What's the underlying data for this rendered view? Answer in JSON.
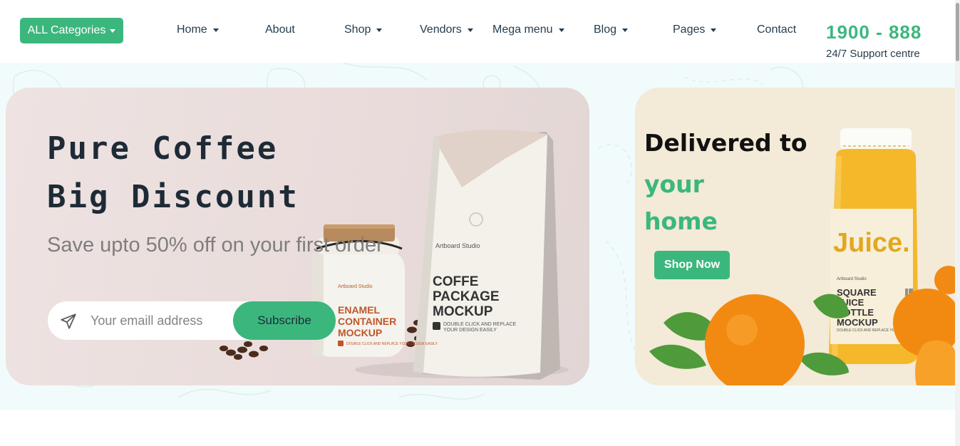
{
  "header": {
    "categories_label": "ALL Categories",
    "nav": [
      {
        "label": "Home",
        "dropdown": true
      },
      {
        "label": "About",
        "dropdown": false
      },
      {
        "label": "Shop",
        "dropdown": true
      },
      {
        "label": "Vendors",
        "dropdown": true
      },
      {
        "label": "Mega menu",
        "dropdown": true
      },
      {
        "label": "Blog",
        "dropdown": true
      },
      {
        "label": "Pages",
        "dropdown": true
      },
      {
        "label": "Contact",
        "dropdown": false
      }
    ],
    "hotline": "1900 - 888",
    "support": "24/7 Support centre"
  },
  "hero": {
    "title_line1": "Pure Coffee",
    "title_line2": "Big Discount",
    "subtitle": "Save upto 50% off on your first order",
    "email_placeholder": "Your emaill address",
    "subscribe_label": "Subscribe",
    "jar": {
      "brand": "Artboard Studio",
      "line1": "ENAMEL",
      "line2": "CONTAINER",
      "line3": "MOCKUP",
      "note": "DOUBLE CLICK AND REPLACE YOUR DESIGN EASILY"
    },
    "bag": {
      "brand": "Artboard Studio",
      "line1": "COFFE",
      "line2": "PACKAGE",
      "line3": "MOCKUP",
      "note1": "DOUBLE CLICK AND REPLACE",
      "note2": "YOUR DESIGN EASILY"
    }
  },
  "side_banner": {
    "title": "Delivered to",
    "green_line1": "your",
    "green_line2": "home",
    "button": "Shop Now",
    "bottle": {
      "logo": "Juice.",
      "brand": "Artboard Studio",
      "line1": "SQUARE",
      "line2": "JUICE",
      "line3": "BOTTLE",
      "line4": "MOCKUP",
      "note": "DOUBLE CLICK AND REPLACE YOUR DESIGN EASILY"
    }
  },
  "colors": {
    "brand_green": "#3bb77e",
    "heading_dark": "#253d4e",
    "hero_band_bg": "#f1fbfb",
    "coffee_banner_bg": "#ebdfde",
    "juice_banner_bg": "#f3ead7"
  }
}
